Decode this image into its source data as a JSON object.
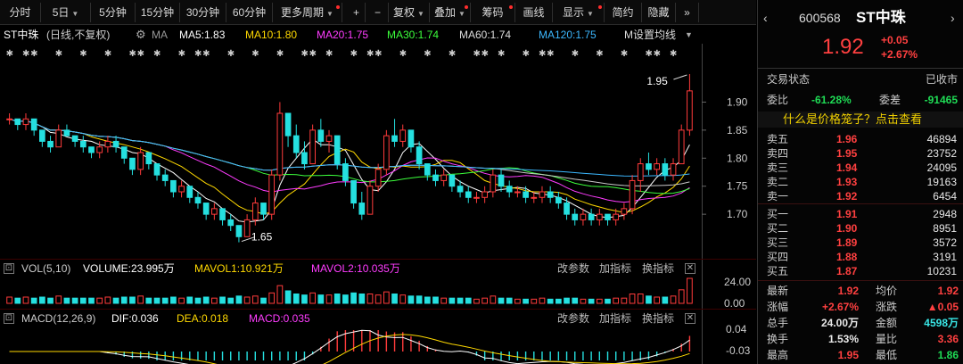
{
  "toolbar": {
    "items": [
      {
        "label": "分时",
        "caret": false,
        "dot": false
      },
      {
        "label": "5日",
        "caret": true,
        "dot": false
      },
      {
        "label": "5分钟",
        "caret": false,
        "dot": false
      },
      {
        "label": "15分钟",
        "caret": false,
        "dot": false
      },
      {
        "label": "30分钟",
        "caret": false,
        "dot": false
      },
      {
        "label": "60分钟",
        "caret": false,
        "dot": false
      },
      {
        "label": "更多周期",
        "caret": true,
        "dot": true
      },
      {
        "label": "+",
        "caret": false,
        "dot": false
      },
      {
        "label": "−",
        "caret": false,
        "dot": false
      },
      {
        "label": "复权",
        "caret": true,
        "dot": false
      },
      {
        "label": "叠加",
        "caret": true,
        "dot": true
      },
      {
        "label": "筹码",
        "caret": false,
        "dot": true
      },
      {
        "label": "画线",
        "caret": false,
        "dot": false
      },
      {
        "label": "显示",
        "caret": true,
        "dot": true
      },
      {
        "label": "简约",
        "caret": false,
        "dot": false
      },
      {
        "label": "隐藏",
        "caret": false,
        "dot": false
      },
      {
        "label": "»",
        "caret": false,
        "dot": false
      }
    ]
  },
  "info": {
    "name": "ST中珠",
    "mode": "(日线,不复权)",
    "ma_label": "MA",
    "ma5": "MA5:1.83",
    "ma10": "MA10:1.80",
    "ma20": "MA20:1.75",
    "ma30": "MA30:1.74",
    "ma60": "MA60:1.74",
    "ma120": "MA120:1.75",
    "ma_setting": "M设置均线"
  },
  "colors": {
    "up": "#ff3b3b",
    "down": "#25e0e0",
    "ma5": "#ffffff",
    "ma10": "#ffd900",
    "ma20": "#ff3cff",
    "ma30": "#3cff3c",
    "ma60": "#c8c8c8",
    "ma120": "#3cb8ff"
  },
  "chart_data": [
    {
      "type": "candlestick",
      "y_ticks": [
        "1.90",
        "1.85",
        "1.80",
        "1.75",
        "1.70"
      ],
      "ylim": [
        1.635,
        1.985
      ],
      "annotations": {
        "high": "1.95",
        "low": "1.65"
      },
      "candles": [
        [
          1.87,
          1.88,
          1.86,
          1.87
        ],
        [
          1.87,
          1.87,
          1.85,
          1.86
        ],
        [
          1.86,
          1.88,
          1.85,
          1.87
        ],
        [
          1.87,
          1.87,
          1.84,
          1.85
        ],
        [
          1.85,
          1.85,
          1.82,
          1.83
        ],
        [
          1.83,
          1.84,
          1.81,
          1.82
        ],
        [
          1.82,
          1.86,
          1.82,
          1.85
        ],
        [
          1.85,
          1.86,
          1.84,
          1.84
        ],
        [
          1.84,
          1.84,
          1.82,
          1.83
        ],
        [
          1.83,
          1.84,
          1.81,
          1.82
        ],
        [
          1.82,
          1.82,
          1.8,
          1.81
        ],
        [
          1.81,
          1.83,
          1.8,
          1.82
        ],
        [
          1.82,
          1.84,
          1.81,
          1.83
        ],
        [
          1.83,
          1.84,
          1.81,
          1.82
        ],
        [
          1.82,
          1.82,
          1.79,
          1.8
        ],
        [
          1.8,
          1.8,
          1.77,
          1.78
        ],
        [
          1.78,
          1.82,
          1.77,
          1.81
        ],
        [
          1.81,
          1.81,
          1.78,
          1.79
        ],
        [
          1.79,
          1.79,
          1.76,
          1.77
        ],
        [
          1.77,
          1.78,
          1.75,
          1.76
        ],
        [
          1.76,
          1.76,
          1.73,
          1.74
        ],
        [
          1.74,
          1.76,
          1.73,
          1.75
        ],
        [
          1.75,
          1.75,
          1.72,
          1.73
        ],
        [
          1.73,
          1.74,
          1.71,
          1.72
        ],
        [
          1.72,
          1.72,
          1.69,
          1.7
        ],
        [
          1.7,
          1.72,
          1.69,
          1.71
        ],
        [
          1.71,
          1.71,
          1.68,
          1.69
        ],
        [
          1.69,
          1.7,
          1.67,
          1.68
        ],
        [
          1.68,
          1.68,
          1.65,
          1.66
        ],
        [
          1.66,
          1.7,
          1.66,
          1.69
        ],
        [
          1.69,
          1.73,
          1.68,
          1.72
        ],
        [
          1.72,
          1.72,
          1.69,
          1.7
        ],
        [
          1.7,
          1.78,
          1.69,
          1.77
        ],
        [
          1.77,
          1.9,
          1.76,
          1.88
        ],
        [
          1.88,
          1.88,
          1.82,
          1.84
        ],
        [
          1.84,
          1.86,
          1.8,
          1.81
        ],
        [
          1.81,
          1.83,
          1.78,
          1.79
        ],
        [
          1.79,
          1.86,
          1.79,
          1.85
        ],
        [
          1.85,
          1.87,
          1.82,
          1.83
        ],
        [
          1.83,
          1.85,
          1.81,
          1.84
        ],
        [
          1.84,
          1.84,
          1.78,
          1.79
        ],
        [
          1.79,
          1.8,
          1.75,
          1.76
        ],
        [
          1.76,
          1.76,
          1.71,
          1.72
        ],
        [
          1.72,
          1.74,
          1.69,
          1.7
        ],
        [
          1.7,
          1.76,
          1.7,
          1.75
        ],
        [
          1.75,
          1.79,
          1.74,
          1.78
        ],
        [
          1.78,
          1.85,
          1.77,
          1.84
        ],
        [
          1.84,
          1.87,
          1.82,
          1.83
        ],
        [
          1.83,
          1.86,
          1.82,
          1.85
        ],
        [
          1.85,
          1.85,
          1.81,
          1.82
        ],
        [
          1.82,
          1.83,
          1.78,
          1.79
        ],
        [
          1.79,
          1.79,
          1.76,
          1.77
        ],
        [
          1.77,
          1.78,
          1.75,
          1.76
        ],
        [
          1.76,
          1.78,
          1.75,
          1.77
        ],
        [
          1.77,
          1.77,
          1.74,
          1.75
        ],
        [
          1.75,
          1.76,
          1.73,
          1.74
        ],
        [
          1.74,
          1.75,
          1.72,
          1.73
        ],
        [
          1.73,
          1.74,
          1.72,
          1.73
        ],
        [
          1.73,
          1.75,
          1.72,
          1.74
        ],
        [
          1.74,
          1.78,
          1.73,
          1.77
        ],
        [
          1.77,
          1.78,
          1.74,
          1.75
        ],
        [
          1.75,
          1.76,
          1.73,
          1.74
        ],
        [
          1.74,
          1.75,
          1.73,
          1.74
        ],
        [
          1.74,
          1.75,
          1.72,
          1.73
        ],
        [
          1.73,
          1.74,
          1.72,
          1.73
        ],
        [
          1.73,
          1.75,
          1.72,
          1.74
        ],
        [
          1.74,
          1.75,
          1.72,
          1.73
        ],
        [
          1.73,
          1.74,
          1.71,
          1.72
        ],
        [
          1.72,
          1.73,
          1.69,
          1.7
        ],
        [
          1.7,
          1.71,
          1.68,
          1.69
        ],
        [
          1.69,
          1.71,
          1.68,
          1.7
        ],
        [
          1.7,
          1.71,
          1.68,
          1.69
        ],
        [
          1.69,
          1.71,
          1.68,
          1.7
        ],
        [
          1.7,
          1.7,
          1.68,
          1.69
        ],
        [
          1.69,
          1.71,
          1.68,
          1.7
        ],
        [
          1.7,
          1.72,
          1.69,
          1.71
        ],
        [
          1.71,
          1.77,
          1.7,
          1.76
        ],
        [
          1.76,
          1.8,
          1.74,
          1.79
        ],
        [
          1.79,
          1.81,
          1.77,
          1.78
        ],
        [
          1.78,
          1.8,
          1.77,
          1.79
        ],
        [
          1.79,
          1.8,
          1.76,
          1.77
        ],
        [
          1.77,
          1.8,
          1.76,
          1.79
        ],
        [
          1.79,
          1.86,
          1.79,
          1.85
        ],
        [
          1.85,
          1.95,
          1.84,
          1.92
        ]
      ],
      "volume": {
        "label": "VOL(5,10)",
        "volume": "VOLUME:23.995万",
        "mavol1": "MAVOL1:10.921万",
        "mavol2": "MAVOL2:10.035万",
        "y_ticks": [
          "24.00",
          "0.00"
        ],
        "values": [
          6,
          5,
          6,
          5,
          6,
          5,
          7,
          5,
          5,
          5,
          5,
          5,
          6,
          5,
          6,
          6,
          7,
          5,
          5,
          5,
          6,
          5,
          6,
          5,
          6,
          5,
          6,
          5,
          7,
          6,
          7,
          5,
          10,
          17,
          12,
          9,
          8,
          10,
          8,
          8,
          9,
          8,
          10,
          9,
          9,
          8,
          11,
          9,
          8,
          7,
          7,
          6,
          6,
          5,
          5,
          5,
          5,
          4,
          5,
          7,
          5,
          5,
          4,
          4,
          4,
          5,
          4,
          4,
          5,
          5,
          4,
          4,
          4,
          4,
          5,
          5,
          9,
          9,
          7,
          6,
          6,
          7,
          13,
          24
        ]
      },
      "macd": {
        "label": "MACD(12,26,9)",
        "dif": "DIF:0.036",
        "dea": "DEA:0.018",
        "macd": "MACD:0.035",
        "y_ticks": [
          "0.04",
          "-0.03"
        ]
      },
      "tools": {
        "params": "改参数",
        "add": "加指标",
        "swap": "换指标",
        "close": "✕"
      }
    }
  ],
  "panel": {
    "code": "600568",
    "name": "ST中珠",
    "price": "1.92",
    "change": "+0.05",
    "change_pct": "+2.67%",
    "status_label": "交易状态",
    "status_value": "已收市",
    "weibi_label": "委比",
    "weibi_value": "-61.28%",
    "weicha_label": "委差",
    "weicha_value": "-91465",
    "banner": "什么是价格笼子？点击查看",
    "asks": [
      {
        "label": "卖五",
        "price": "1.96",
        "vol": "46894"
      },
      {
        "label": "卖四",
        "price": "1.95",
        "vol": "23752"
      },
      {
        "label": "卖三",
        "price": "1.94",
        "vol": "24095"
      },
      {
        "label": "卖二",
        "price": "1.93",
        "vol": "19163"
      },
      {
        "label": "卖一",
        "price": "1.92",
        "vol": "6454"
      }
    ],
    "bids": [
      {
        "label": "买一",
        "price": "1.91",
        "vol": "2948"
      },
      {
        "label": "买二",
        "price": "1.90",
        "vol": "8951"
      },
      {
        "label": "买三",
        "price": "1.89",
        "vol": "3572"
      },
      {
        "label": "买四",
        "price": "1.88",
        "vol": "3191"
      },
      {
        "label": "买五",
        "price": "1.87",
        "vol": "10231"
      }
    ],
    "stats": [
      {
        "l1": "最新",
        "v1": "1.92",
        "c1": "red",
        "l2": "均价",
        "v2": "1.92",
        "c2": "red"
      },
      {
        "l1": "涨幅",
        "v1": "+2.67%",
        "c1": "red",
        "l2": "涨跌",
        "v2": "▲0.05",
        "c2": "red"
      },
      {
        "l1": "总手",
        "v1": "24.00万",
        "c1": "white",
        "l2": "金额",
        "v2": "4598万",
        "c2": "cyan"
      },
      {
        "l1": "换手",
        "v1": "1.53%",
        "c1": "white",
        "l2": "量比",
        "v2": "3.36",
        "c2": "red"
      },
      {
        "l1": "最高",
        "v1": "1.95",
        "c1": "red",
        "l2": "最低",
        "v2": "1.86",
        "c2": "green"
      }
    ]
  }
}
